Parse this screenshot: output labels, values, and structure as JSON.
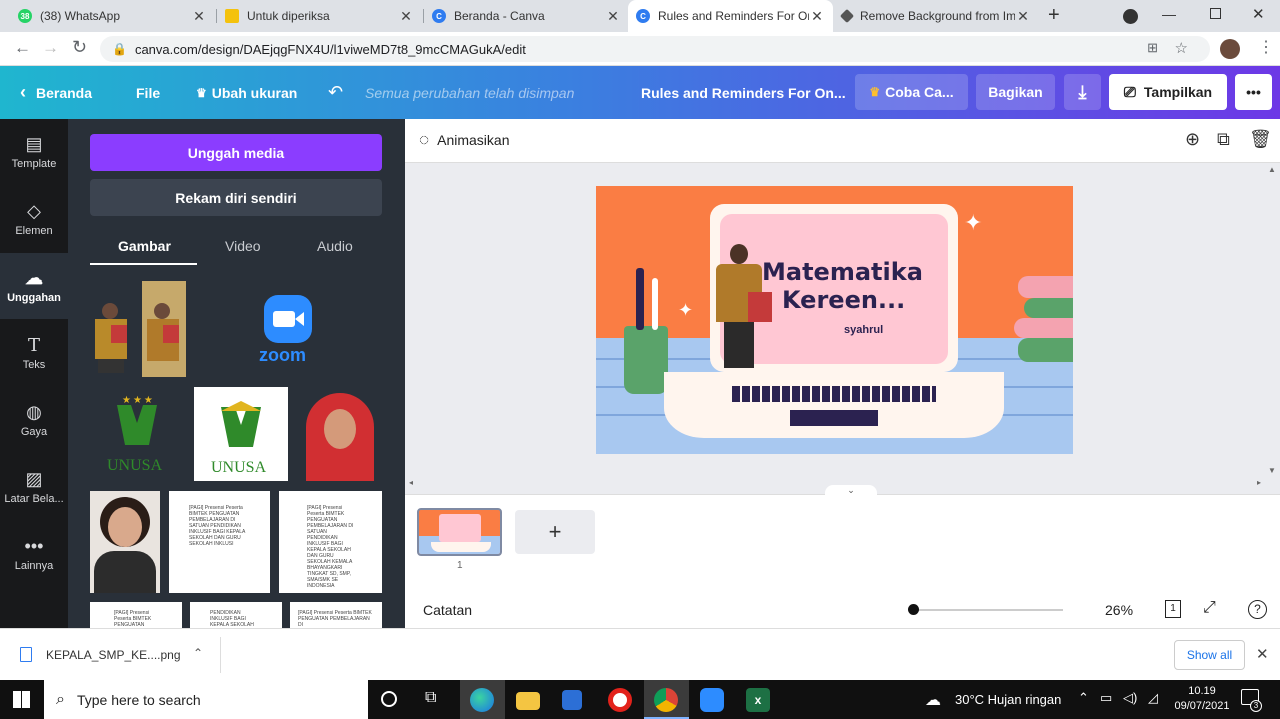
{
  "browser": {
    "tabs": [
      {
        "title": "(38) WhatsApp",
        "badge": "38"
      },
      {
        "title": "Untuk diperiksa"
      },
      {
        "title": "Beranda - Canva"
      },
      {
        "title": "Rules and Reminders For Onl"
      },
      {
        "title": "Remove Background from Im"
      }
    ],
    "new_tab": "+",
    "url": "canva.com/design/DAEjqgFNX4U/l1viweMD7t8_9mcCMAGukA/edit"
  },
  "header": {
    "back_label": "Beranda",
    "file_label": "File",
    "resize_label": "Ubah ukuran",
    "saved_status": "Semua perubahan telah disimpan",
    "doc_title": "Rules and Reminders For On...",
    "try_label": "Coba Ca...",
    "share_label": "Bagikan",
    "present_label": "Tampilkan",
    "more_label": "•••"
  },
  "rail": [
    {
      "label": "Template"
    },
    {
      "label": "Elemen"
    },
    {
      "label": "Unggahan"
    },
    {
      "label": "Teks"
    },
    {
      "label": "Gaya"
    },
    {
      "label": "Latar Bela..."
    },
    {
      "label": "Lainnya"
    }
  ],
  "panel": {
    "upload_label": "Unggah media",
    "record_label": "Rekam diri sendiri",
    "tabs": [
      "Gambar",
      "Video",
      "Audio"
    ],
    "zoom_text": "zoom",
    "unusa_text": "UNUSA",
    "doc_text_1": "[PAGI] Presensi Peserta BIMTEK PENGUATAN PEMBELAJARAN DI SATUAN PENDIDIKAN INKLUSIF BAGI KEPALA SEKOLAH DAN GURU SEKOLAH INKLUSI",
    "doc_text_2": "[PAGI] Presensi Peserta BIMTEK PENGUATAN PEMBELAJARAN DI SATUAN PENDIDIKAN INKLUSIF BAGI KEPALA SEKOLAH DAN GURU SEKOLAH KEMALA BHAYANGKARI TINGKAT SD, SMP, SMA/SMK SE INDONESIA",
    "doc_text_3": "[PAGI] Presensi Peserta BIMTEK PENGUATAN PEMBELAJARAN DI SATUAN PENDIDIKAN INKLUSIF BAGI KEPALA SEKOLAH DAN GURU SEKOLAH KEMALA BHAYANGKARI TINGKAT SD, SMP, SMA/SMK SE INDONESIA",
    "doc_text_4": "[PAGI] Presensi Peserta BIMTEK PENGUATAN",
    "doc_text_5": "PENDIDIKAN INKLUSIF BAGI KEPALA SEKOLAH",
    "doc_text_6": "[PAGI] Presensi Peserta BIMTEK PENGUATAN PEMBELAJARAN DI"
  },
  "editor": {
    "animate_label": "Animasikan",
    "slide_title_1": "Matematika",
    "slide_title_2": "Kereen...",
    "slide_author": "syahrul",
    "page_number": "1",
    "add_page": "+",
    "notes_label": "Catatan",
    "zoom": "26%",
    "zoom_level": 0.0,
    "page_count": "1",
    "help": "?"
  },
  "downloads": {
    "file_name": "KEPALA_SMP_KE....png",
    "show_all": "Show all"
  },
  "taskbar": {
    "search_placeholder": "Type here to search",
    "weather": "30°C  Hujan ringan",
    "time": "10.19",
    "date": "09/07/2021",
    "notif_count": "3"
  },
  "colors": {
    "purple": "#8b3dff",
    "slide_orange": "#fa7d44",
    "slide_pink": "#ffc7d3",
    "slide_title": "#2b2250"
  }
}
